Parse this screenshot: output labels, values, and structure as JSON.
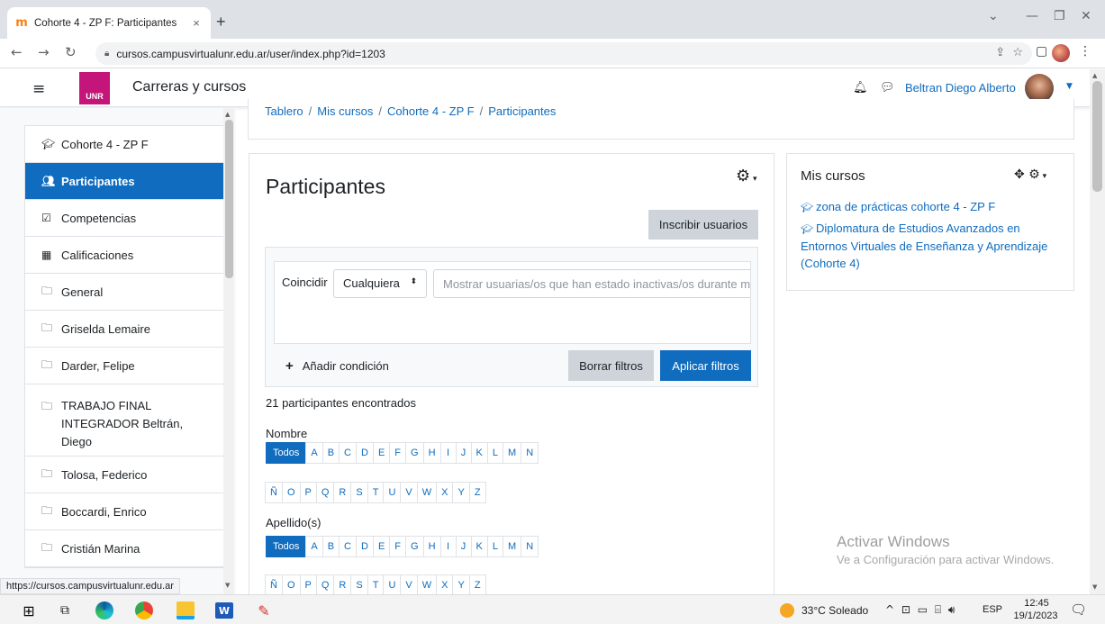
{
  "browser": {
    "tab_title": "Cohorte 4 - ZP F: Participantes",
    "tab_close": "×",
    "new_tab": "+",
    "url": "cursos.campusvirtualunr.edu.ar/user/index.php?id=1203",
    "status_url": "https://cursos.campusvirtualunr.edu.ar"
  },
  "navbar": {
    "logo_text": "UNR",
    "site_name": "Carreras y cursos",
    "user_name": "Beltran Diego Alberto"
  },
  "drawer": {
    "items": [
      {
        "icon": "graduation-cap-icon",
        "label": "Cohorte 4 - ZP F"
      },
      {
        "icon": "users-icon",
        "label": "Participantes"
      },
      {
        "icon": "checkbox-icon",
        "label": "Competencias"
      },
      {
        "icon": "table-icon",
        "label": "Calificaciones"
      },
      {
        "icon": "folder-icon",
        "label": "General"
      },
      {
        "icon": "folder-icon",
        "label": "Griselda Lemaire"
      },
      {
        "icon": "folder-icon",
        "label": "Darder, Felipe"
      },
      {
        "icon": "folder-icon",
        "label": "TRABAJO FINAL\nINTEGRADOR Beltrán,\nDiego"
      },
      {
        "icon": "folder-icon",
        "label": "Tolosa, Federico"
      },
      {
        "icon": "folder-icon",
        "label": "Boccardi, Enrico"
      },
      {
        "icon": "folder-icon",
        "label": "Cristián Marina"
      }
    ]
  },
  "breadcrumb": {
    "items": [
      "Tablero",
      "Mis cursos",
      "Cohorte 4 - ZP F",
      "Participantes"
    ],
    "separator": "/"
  },
  "main": {
    "title": "Participantes",
    "enrol_button": "Inscribir usuarios",
    "filter": {
      "match_label": "Coincidir",
      "match_value": "Cualquiera",
      "inactive_placeholder": "Mostrar usuarias/os que han estado inactivas/os durante más de",
      "add_condition": "Añadir condición",
      "clear_button": "Borrar filtros",
      "apply_button": "Aplicar filtros"
    },
    "count_text": "21 participantes encontrados",
    "first_name_label": "Nombre",
    "last_name_label": "Apellido(s)",
    "all_label": "Todos",
    "letters_row1": [
      "A",
      "B",
      "C",
      "D",
      "E",
      "F",
      "G",
      "H",
      "I",
      "J",
      "K",
      "L",
      "M",
      "N"
    ],
    "letters_row2": [
      "Ñ",
      "O",
      "P",
      "Q",
      "R",
      "S",
      "T",
      "U",
      "V",
      "W",
      "X",
      "Y",
      "Z"
    ]
  },
  "block": {
    "title": "Mis cursos",
    "courses": [
      "zona de prácticas cohorte 4 - ZP F",
      "Diplomatura de Estudios Avanzados en Entornos Virtuales de Enseñanza y Aprendizaje (Cohorte 4)"
    ]
  },
  "watermark": {
    "title": "Activar Windows",
    "subtitle": "Ve a Configuración para activar Windows."
  },
  "taskbar": {
    "weather": "33°C Soleado",
    "language": "ESP",
    "time": "12:45",
    "date": "19/1/2023"
  },
  "colors": {
    "primary": "#0f6cbf",
    "logo": "#c4167a",
    "secondary_button": "#ced4da"
  }
}
